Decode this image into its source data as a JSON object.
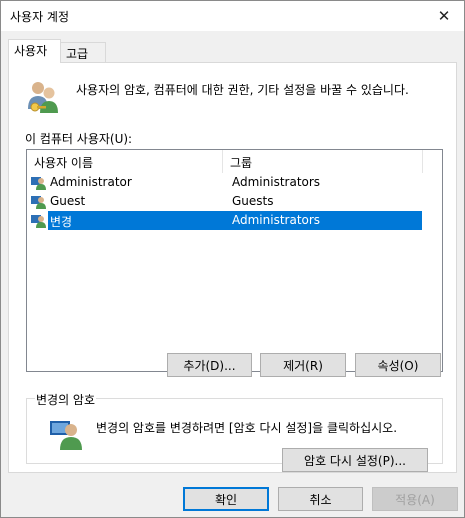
{
  "window": {
    "title": "사용자 계정",
    "close_glyph": "✕"
  },
  "tabs": [
    {
      "label": "사용자",
      "active": true
    },
    {
      "label": "고급",
      "active": false
    }
  ],
  "users_tab": {
    "intro_text": "사용자의 암호, 컴퓨터에 대한 권한, 기타 설정을 바꿀 수 있습니다.",
    "list_label": "이 컴퓨터 사용자(U):",
    "columns": [
      "사용자 이름",
      "그룹"
    ],
    "rows": [
      {
        "name": "Administrator",
        "group": "Administrators",
        "selected": false
      },
      {
        "name": "Guest",
        "group": "Guests",
        "selected": false
      },
      {
        "name": "변경",
        "group": "Administrators",
        "selected": true
      }
    ],
    "buttons": {
      "add": "추가(D)...",
      "remove": "제거(R)",
      "properties": "속성(O)"
    },
    "password_group": {
      "title": "변경의 암호",
      "text": "변경의 암호를 변경하려면 [암호 다시 설정]을 클릭하십시오.",
      "reset_button": "암호 다시 설정(P)..."
    }
  },
  "footer": {
    "ok": "확인",
    "cancel": "취소",
    "apply": "적용(A)"
  },
  "colors": {
    "selection": "#0078d7",
    "window_bg": "#f0f0f0",
    "panel_bg": "#ffffff"
  },
  "icons": [
    "users-icon",
    "user-icon",
    "user-key-icon",
    "close-icon"
  ]
}
